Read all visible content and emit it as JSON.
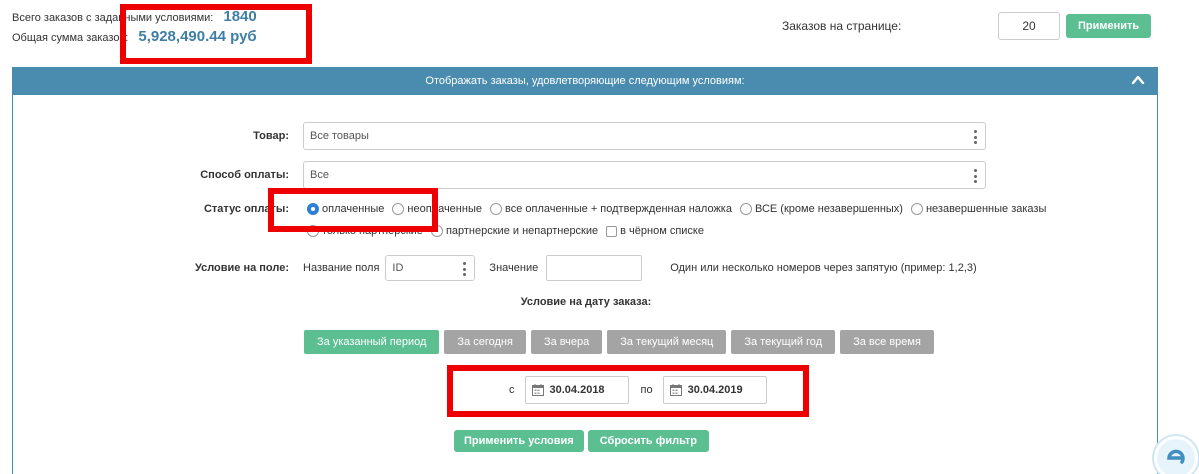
{
  "summary": {
    "total_orders_label": "Всего заказов с заданными условиями:",
    "total_orders_value": "1840",
    "total_sum_label": "Общая сумма заказов:",
    "total_sum_value": "5,928,490.44 руб"
  },
  "per_page": {
    "label": "Заказов на странице:",
    "value": "20",
    "apply_label": "Применить"
  },
  "filter_panel": {
    "header": "Отображать заказы, удовлетворяющие следующим условиям:",
    "product": {
      "label": "Товар:",
      "value": "Все товары"
    },
    "payment": {
      "label": "Способ оплаты:",
      "value": "Все"
    },
    "status": {
      "label": "Статус оплаты:",
      "options": [
        {
          "label": "оплаченные",
          "checked": true
        },
        {
          "label": "неоплаченные",
          "checked": false
        },
        {
          "label": "все оплаченные + подтвержденная наложка",
          "checked": false
        },
        {
          "label": "ВСЕ (кроме незавершенных)",
          "checked": false
        },
        {
          "label": "незавершенные заказы",
          "checked": false
        },
        {
          "label": "только партнерские",
          "checked": false
        },
        {
          "label": "партнерские и непартнерские",
          "checked": false
        }
      ],
      "blacklist_label": "в чёрном списке"
    },
    "field_condition": {
      "label": "Условие на поле:",
      "field_name_label": "Название поля",
      "field_name_value": "ID",
      "value_label": "Значение",
      "value": "",
      "hint": "Один или несколько номеров через запятую (пример: 1,2,3)"
    },
    "date_condition": {
      "label": "Условие на дату заказа:",
      "periods": [
        {
          "label": "За указанный период",
          "active": true
        },
        {
          "label": "За сегодня",
          "active": false
        },
        {
          "label": "За вчера",
          "active": false
        },
        {
          "label": "За текущий месяц",
          "active": false
        },
        {
          "label": "За текущий год",
          "active": false
        },
        {
          "label": "За все время",
          "active": false
        }
      ],
      "from_label": "с",
      "from_value": "30.04.2018",
      "to_label": "по",
      "to_value": "30.04.2019"
    },
    "apply_conditions_label": "Применить условия",
    "reset_filter_label": "Сбросить фильтр"
  },
  "colors": {
    "accent_blue": "#4a8cb0",
    "accent_green": "#5bbf92",
    "highlight_red": "#ee0000",
    "button_gray": "#a4a4a4"
  },
  "icons": {
    "collapse": "chevron-up-icon",
    "select_menu": "kebab-menu-icon",
    "date": "calendar-icon",
    "corner_logo": "logo-icon"
  }
}
